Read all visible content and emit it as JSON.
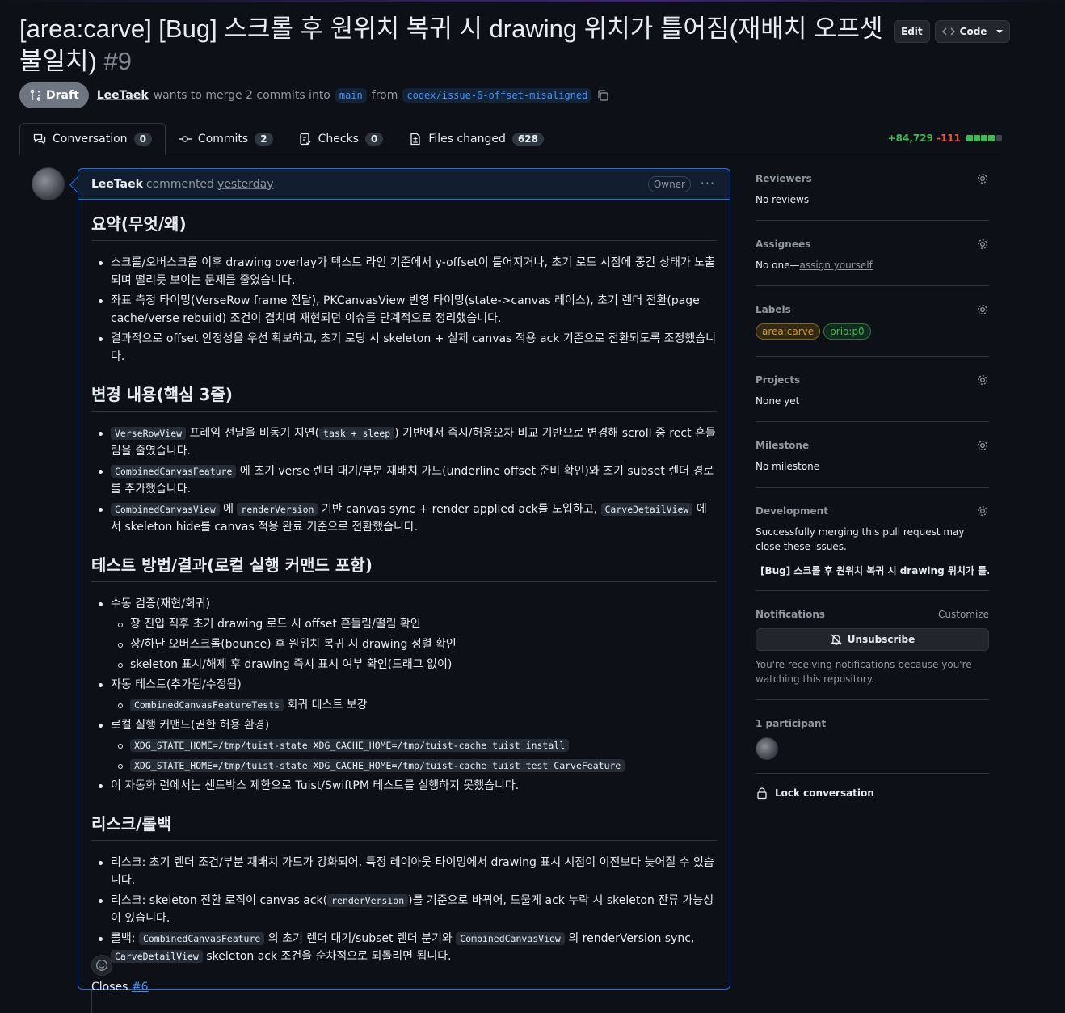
{
  "pr": {
    "title": "[area:carve] [Bug] 스크롤 후 원위치 복귀 시 drawing 위치가 틀어짐(재배치 오프셋 불일치)",
    "number": "#9",
    "edit_label": "Edit",
    "code_label": "Code",
    "state": "Draft",
    "author": "LeeTaek",
    "merge_text": "wants to merge 2 commits into",
    "base_branch": "main",
    "from_text": "from",
    "head_branch": "codex/issue-6-offset-misaligned"
  },
  "tabs": [
    {
      "label": "Conversation",
      "count": "0"
    },
    {
      "label": "Commits",
      "count": "2"
    },
    {
      "label": "Checks",
      "count": "0"
    },
    {
      "label": "Files changed",
      "count": "628"
    }
  ],
  "diffstat": {
    "additions": "+84,729",
    "deletions": "-111"
  },
  "comment": {
    "author": "LeeTaek",
    "action": "commented",
    "time": "yesterday",
    "role": "Owner",
    "more": "···",
    "h_summary": "요약(무엇/왜)",
    "summary": [
      "스크롤/오버스크롤 이후 drawing overlay가 텍스트 라인 기준에서 y-offset이 틀어지거나, 초기 로드 시점에 중간 상태가 노출되며 떨리듯 보이는 문제를 줄였습니다.",
      "좌표 측정 타이밍(VerseRow frame 전달), PKCanvasView 반영 타이밍(state->canvas 레이스), 초기 렌더 전환(page cache/verse rebuild) 조건이 겹치며 재현되던 이슈를 단계적으로 정리했습니다.",
      "결과적으로 offset 안정성을 우선 확보하고, 초기 로딩 시 skeleton + 실제 canvas 적용 ack 기준으로 전환되도록 조정했습니다."
    ],
    "h_changes": "변경 내용(핵심 3줄)",
    "c1_code": "VerseRowView",
    "c1_a": "프레임 전달을 비동기 지연(",
    "c1_code2": "task + sleep",
    "c1_b": ") 기반에서 즉시/허용오차 비교 기반으로 변경해 scroll 중 rect 흔들림을 줄였습니다.",
    "c2_code": "CombinedCanvasFeature",
    "c2_a": "에 초기 verse 렌더 대기/부분 재배치 가드(underline offset 준비 확인)와 초기 subset 렌더 경로를 추가했습니다.",
    "c3_code": "CombinedCanvasView",
    "c3_a": "에",
    "c3_code2": "renderVersion",
    "c3_b": "기반 canvas sync + render applied ack를 도입하고,",
    "c3_code3": "CarveDetailView",
    "c3_c": "에서 skeleton hide를 canvas 적용 완료 기준으로 전환했습니다.",
    "h_test": "테스트 방법/결과(로컬 실행 커맨드 포함)",
    "t_manual": "수동 검증(재현/회귀)",
    "t_manual_items": [
      "장 진입 직후 초기 drawing 로드 시 offset 흔들림/떨림 확인",
      "상/하단 오버스크롤(bounce) 후 원위치 복귀 시 drawing 정렬 확인",
      "skeleton 표시/해제 후 drawing 즉시 표시 여부 확인(드래그 없이)"
    ],
    "t_auto": "자동 테스트(추가됨/수정됨)",
    "t_auto_code": "CombinedCanvasFeatureTests",
    "t_auto_text": "회귀 테스트 보강",
    "t_local": "로컬 실행 커맨드(권한 허용 환경)",
    "t_cmd1": "XDG_STATE_HOME=/tmp/tuist-state XDG_CACHE_HOME=/tmp/tuist-cache tuist install",
    "t_cmd2": "XDG_STATE_HOME=/tmp/tuist-state XDG_CACHE_HOME=/tmp/tuist-cache tuist test CarveFeature",
    "t_note": "이 자동화 런에서는 샌드박스 제한으로 Tuist/SwiftPM 테스트를 실행하지 못했습니다.",
    "h_risk": "리스크/롤백",
    "r1": "리스크: 초기 렌더 조건/부분 재배치 가드가 강화되어, 특정 레이아웃 타이밍에서 drawing 표시 시점이 이전보다 늦어질 수 있습니다.",
    "r2_a": "리스크: skeleton 전환 로직이 canvas ack(",
    "r2_code": "renderVersion",
    "r2_b": ")를 기준으로 바뀌어, 드물게 ack 누락 시 skeleton 잔류 가능성이 있습니다.",
    "r3_a": "롤백:",
    "r3_code": "CombinedCanvasFeature",
    "r3_b": "의 초기 렌더 대기/subset 렌더 분기와",
    "r3_code2": "CombinedCanvasView",
    "r3_c": "의 renderVersion sync,",
    "r3_code3": "CarveDetailView",
    "r3_d": "skeleton ack 조건을 순차적으로 되돌리면 됩니다.",
    "closes_text": "Closes",
    "closes_ref": "#6"
  },
  "sidebar": {
    "reviewers_title": "Reviewers",
    "reviewers_value": "No reviews",
    "assignees_title": "Assignees",
    "assignees_value": "No one—",
    "assign_link": "assign yourself",
    "labels_title": "Labels",
    "labels": [
      {
        "name": "area:carve",
        "color": "#d29922"
      },
      {
        "name": "prio:p0",
        "color": "#3fb950"
      }
    ],
    "projects_title": "Projects",
    "projects_value": "None yet",
    "milestone_title": "Milestone",
    "milestone_value": "No milestone",
    "development_title": "Development",
    "development_text": "Successfully merging this pull request may close these issues.",
    "development_issue": "[Bug] 스크롤 후 원위치 복귀 시 drawing 위치가 틀...",
    "notifications_title": "Notifications",
    "customize": "Customize",
    "unsubscribe": "Unsubscribe",
    "notifications_note": "You're receiving notifications because you're watching this repository.",
    "participants_title": "1 participant",
    "lock": "Lock conversation"
  }
}
